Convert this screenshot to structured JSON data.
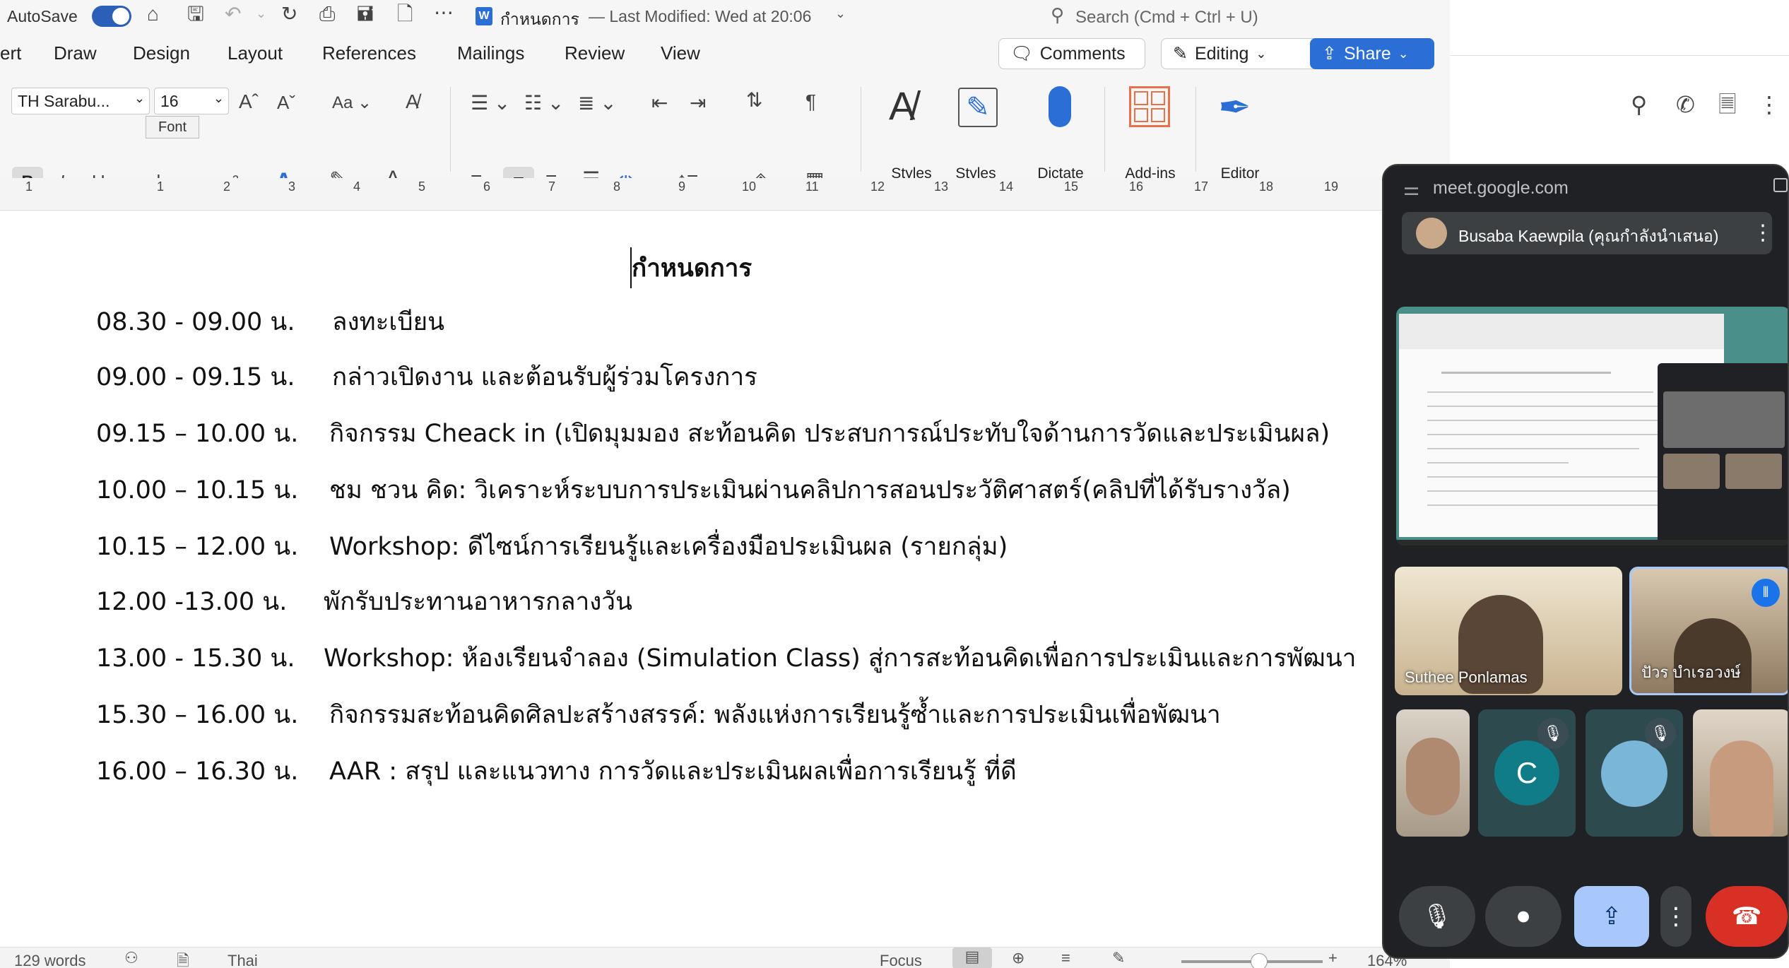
{
  "titlebar": {
    "autosave": "AutoSave",
    "doc_name": "กำหนดการ",
    "last_modified": "— Last Modified: Wed at 20:06",
    "search_placeholder": "Search (Cmd + Ctrl + U)"
  },
  "ribbon": {
    "tabs": [
      "ert",
      "Draw",
      "Design",
      "Layout",
      "References",
      "Mailings",
      "Review",
      "View"
    ],
    "comments": "Comments",
    "editing": "Editing",
    "share": "Share",
    "font_name": "TH Sarabu...",
    "font_size": "16",
    "tooltip": "Font",
    "big_buttons": [
      {
        "label": "Styles",
        "icon": "styles-icon"
      },
      {
        "label": "Styles\nPane",
        "icon": "styles-pane-icon"
      },
      {
        "label": "Dictate",
        "icon": "microphone-icon"
      },
      {
        "label": "Add-ins",
        "icon": "add-ins-icon"
      },
      {
        "label": "Editor",
        "icon": "editor-icon"
      }
    ]
  },
  "ruler": {
    "ticks": [
      "1",
      "1",
      "2",
      "3",
      "4",
      "5",
      "6",
      "7",
      "8",
      "9",
      "10",
      "11",
      "12",
      "13",
      "14",
      "15",
      "16",
      "17",
      "18",
      "19"
    ]
  },
  "document": {
    "title": "กำหนดการ",
    "rows": [
      {
        "time": "08.30 - 09.00 น.",
        "activity": "ลงทะเบียน"
      },
      {
        "time": "09.00 - 09.15 น.",
        "activity": "กล่าวเปิดงาน และต้อนรับผู้ร่วมโครงการ"
      },
      {
        "time": "09.15 – 10.00 น.",
        "activity": "กิจกรรม Cheack in (เปิดมุมมอง สะท้อนคิด ประสบการณ์ประทับใจด้านการวัดและประเมินผล)"
      },
      {
        "time": "10.00 – 10.15 น.",
        "activity": "ชม ชวน คิด: วิเคราะห์ระบบการประเมินผ่านคลิปการสอนประวัติศาสตร์(คลิปที่ได้รับรางวัล)"
      },
      {
        "time": "10.15 – 12.00 น.",
        "activity": "Workshop: ดีไซน์การเรียนรู้และเครื่องมือประเมินผล (รายกลุ่ม)"
      },
      {
        "time": "12.00 -13.00 น.",
        "activity": "พักรับประทานอาหารกลางวัน"
      },
      {
        "time": "13.00 - 15.30 น.",
        "activity": "Workshop: ห้องเรียนจำลอง (Simulation Class) สู่การสะท้อนคิดเพื่อการประเมินและการพัฒนา"
      },
      {
        "time": "15.30 – 16.00 น.",
        "activity": "กิจกรรมสะท้อนคิดศิลปะสร้างสรรค์: พลังแห่งการเรียนรู้ซ้ำและการประเมินเพื่อพัฒนา"
      },
      {
        "time": "16.00 – 16.30 น.",
        "activity": "AAR : สรุป และแนวทาง การวัดและประเมินผลเพื่อการเรียนรู้ ที่ดี"
      }
    ]
  },
  "statusbar": {
    "words": "129 words",
    "language": "Thai",
    "focus": "Focus",
    "zoom": "164%"
  },
  "meet": {
    "url": "meet.google.com",
    "presenter": "Busaba Kaewpila (คุณกำลังนำเสนอ)",
    "participants": [
      {
        "name": "Suthee Ponlamas"
      },
      {
        "name": "ปัวร บำเรอวงษ์"
      }
    ],
    "avatar_letter": "C"
  },
  "colors": {
    "share_blue": "#2b6fd6",
    "meet_bg": "#202124",
    "end_call_red": "#d93025",
    "present_blue": "#a8c7fa"
  }
}
